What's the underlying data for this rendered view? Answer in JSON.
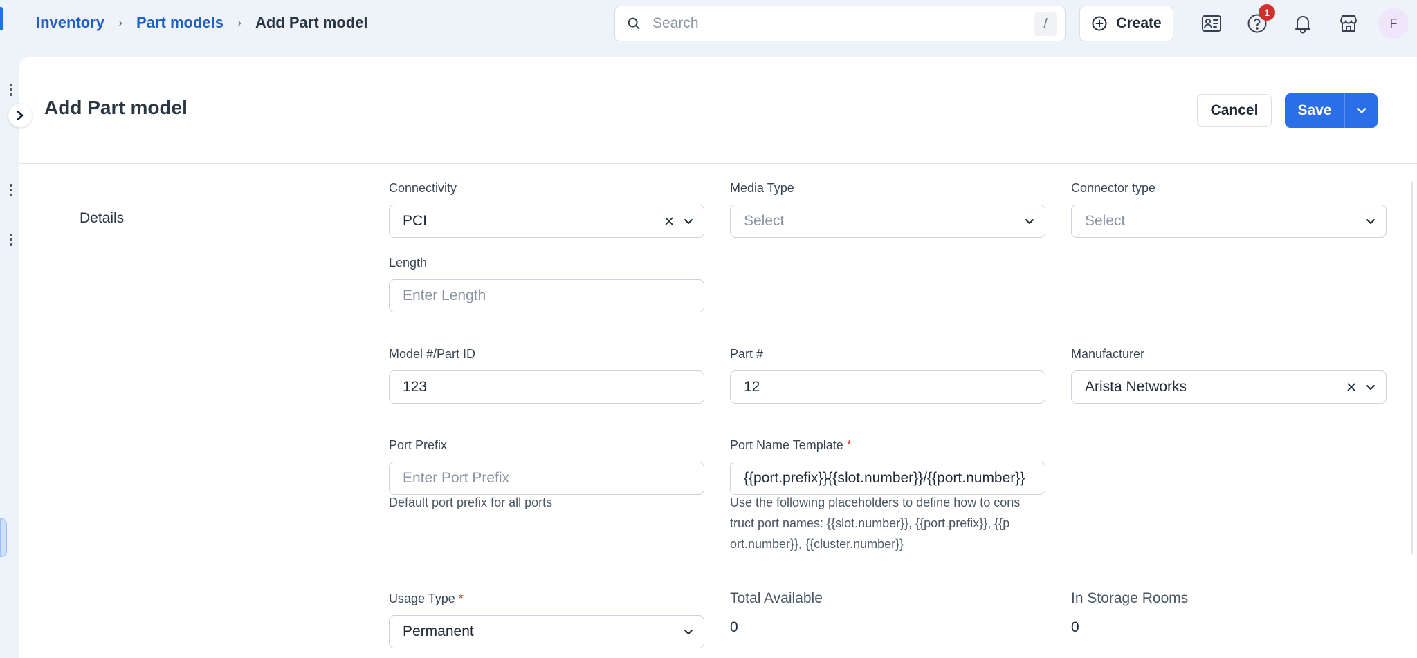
{
  "breadcrumb": {
    "items": [
      "Inventory",
      "Part models"
    ],
    "current": "Add Part model"
  },
  "search": {
    "placeholder": "Search",
    "shortcut": "/"
  },
  "header_actions": {
    "create_label": "Create",
    "help_badge_count": "1",
    "avatar_initial": "F"
  },
  "icons": {
    "search": "search-icon",
    "create": "plus-circle-icon",
    "contacts": "contact-list-icon",
    "help": "help-circle-icon",
    "notifications": "bell-icon",
    "store": "store-icon",
    "expand": "chevron-right-icon"
  },
  "page": {
    "title": "Add Part model",
    "cancel_label": "Cancel",
    "save_label": "Save"
  },
  "side_nav": {
    "items": [
      "Details"
    ]
  },
  "form": {
    "connectivity": {
      "label": "Connectivity",
      "value": "PCI"
    },
    "media_type": {
      "label": "Media Type",
      "placeholder": "Select"
    },
    "connector_type": {
      "label": "Connector type",
      "placeholder": "Select"
    },
    "length": {
      "label": "Length",
      "placeholder": "Enter Length"
    },
    "model_id": {
      "label": "Model #/Part ID",
      "value": "123"
    },
    "part_number": {
      "label": "Part #",
      "value": "12"
    },
    "manufacturer": {
      "label": "Manufacturer",
      "value": "Arista Networks"
    },
    "port_prefix": {
      "label": "Port Prefix",
      "placeholder": "Enter Port Prefix",
      "help": "Default port prefix for all ports"
    },
    "port_name_template": {
      "label": "Port Name Template",
      "required_mark": "*",
      "value": "{{port.prefix}}{{slot.number}}/{{port.number}}",
      "help_lines": [
        "Use the following placeholders to define how to cons",
        "truct port names: {{slot.number}}, {{port.prefix}}, {{p",
        "ort.number}}, {{cluster.number}}"
      ]
    },
    "usage_type": {
      "label": "Usage Type",
      "required_mark": "*",
      "value": "Permanent"
    },
    "total_available": {
      "label": "Total Available",
      "value": "0"
    },
    "in_storage_rooms": {
      "label": "In Storage Rooms",
      "value": "0"
    }
  },
  "colors": {
    "primary": "#2b6fe8",
    "link": "#1f5fc9",
    "danger": "#d32f2f",
    "background": "#eef3fa"
  }
}
